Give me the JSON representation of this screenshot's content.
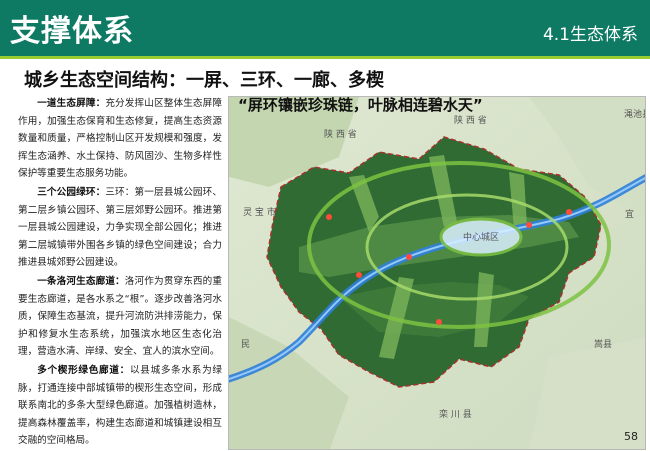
{
  "header": {
    "title": "支撑体系",
    "section": "4.1生态体系"
  },
  "subtitle": "城乡生态空间结构：一屏、三环、一廊、多楔",
  "slogan": "“屏环镶嵌珍珠链，叶脉相连碧水天”",
  "page_number": "58",
  "paragraphs": [
    {
      "heading": "一道生态屏障：",
      "text": "充分发挥山区整体生态屏障作用，加强生态保育和生态修复，提高生态资源数量和质量，严格控制山区开发规模和强度，发挥生态涵养、水土保持、防风固沙、生物多样性保护等重要生态服务功能。"
    },
    {
      "heading": "三个公园绿环：",
      "text": "三环：第一层县城公园环、第二层乡镇公园环、第三层郊野公园环。推进第一层县城公园建设，力争实现全部公园化；推进第二层城镇带外围各乡镇的绿色空间建设；合力推进县城郊野公园建设。"
    },
    {
      "heading": "一条洛河生态廊道：",
      "text": "洛河作为贯穿东西的重要生态廊道，是各水系之“根”。逐步改善洛河水质，保障生态基流，提升河流防洪排涝能力，保护和修复水生态系统，加强滨水地区生态化治理，营造水清、岸绿、安全、宜人的滨水空间。"
    },
    {
      "heading": "多个楔形绿色廊道：",
      "text": "以县城多条水系为绿脉，打通连接中部城镇带的楔形生态空间，形成联系南北的多条大型绿色廊道。加强植树造林，提高森林覆盖率，构建生态廊道和城镇建设相互交融的空间格局。"
    }
  ],
  "map": {
    "labels": {
      "city_center": "中心城区",
      "shaanxi_a": "陕 西 省",
      "shaanxi_b": "陕 西 省",
      "lingbao": "灵 宝 市",
      "mianchi": "渑池县",
      "yi": "宜",
      "min": "民",
      "songxian": "嵩县",
      "luanchuan": "栾 川 县"
    }
  },
  "colors": {
    "header": "#0f7a64",
    "header_rule": "#9acd32",
    "river": "#2f7fd9",
    "ring": "#7cc242"
  }
}
